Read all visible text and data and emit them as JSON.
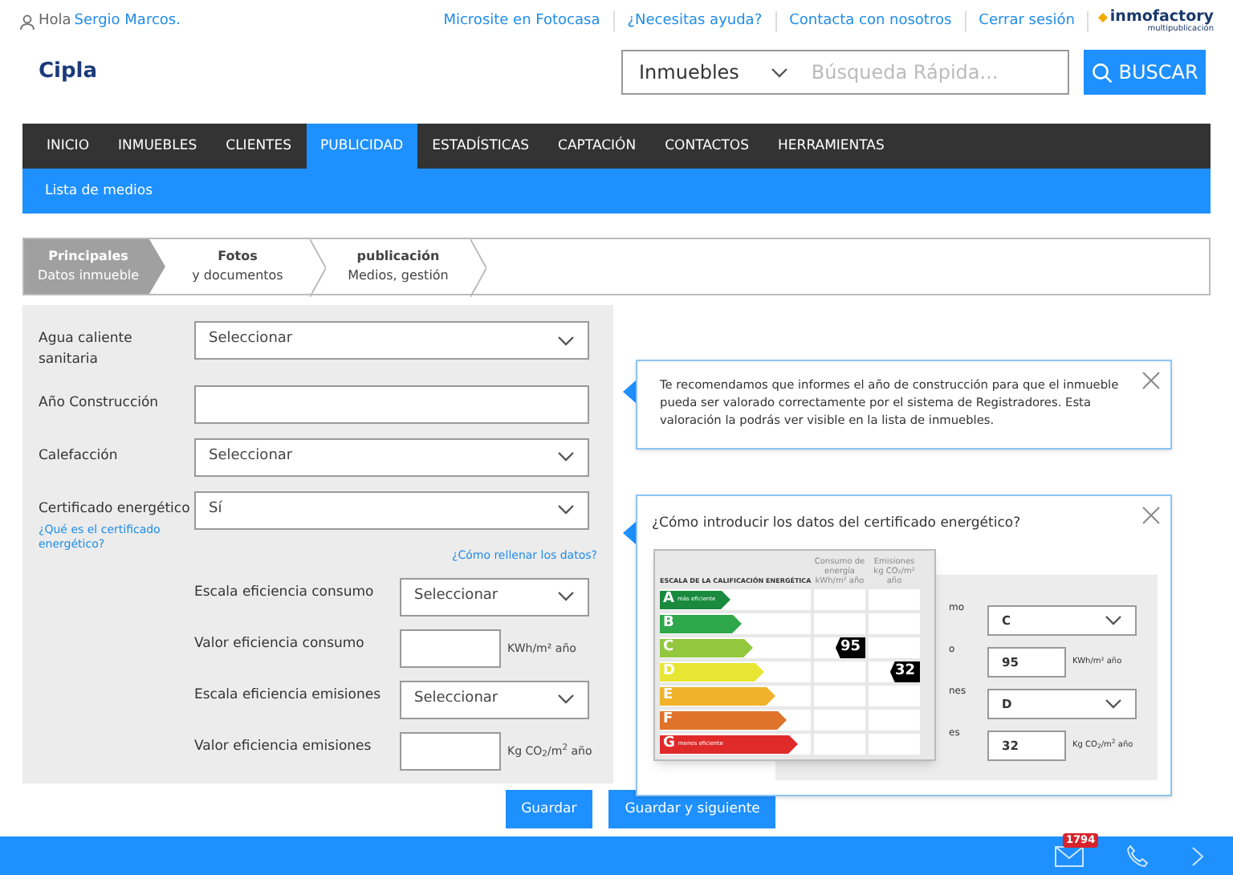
{
  "header": {
    "greeting": "Hola",
    "user": "Sergio Marcos.",
    "links": [
      "Microsite en Fotocasa",
      "¿Necesitas ayuda?",
      "Contacta con nosotros",
      "Cerrar sesión"
    ],
    "brand": "inmofactory",
    "brand_sub": "multipublicación",
    "logo": "Cipla"
  },
  "search": {
    "category": "Inmuebles",
    "placeholder": "Búsqueda Rápida...",
    "button": "BUSCAR"
  },
  "nav": [
    {
      "label": "INICIO",
      "selected": false
    },
    {
      "label": "INMUEBLES",
      "selected": false
    },
    {
      "label": "CLIENTES",
      "selected": false
    },
    {
      "label": "PUBLICIDAD",
      "selected": true
    },
    {
      "label": "ESTADÍSTICAS",
      "selected": false
    },
    {
      "label": "CAPTACIÓN",
      "selected": false
    },
    {
      "label": "CONTACTOS",
      "selected": false
    },
    {
      "label": "HERRAMIENTAS",
      "selected": false
    }
  ],
  "subnav": "Lista de medios",
  "steps": [
    {
      "title": "Principales",
      "subtitle": "Datos inmueble",
      "selected": true
    },
    {
      "title": "Fotos",
      "subtitle": "y documentos",
      "selected": false
    },
    {
      "title": "publicación",
      "subtitle": "Medios, gestión",
      "selected": false
    }
  ],
  "fields": [
    {
      "label": "Agua caliente sanitaria",
      "kind": "select",
      "value": "Seleccionar"
    },
    {
      "label": "Año Construcción",
      "kind": "text"
    },
    {
      "label": "Calefacción",
      "kind": "select",
      "value": "Seleccionar"
    },
    {
      "label": "Certificado energético",
      "kind": "select",
      "value": "Sí",
      "link": "¿Qué es el certificado energético?"
    }
  ],
  "help_link": "¿Cómo rellenar los datos?",
  "subfields": [
    {
      "label": "Escala eficiencia consumo",
      "kind": "select",
      "value": "Seleccionar"
    },
    {
      "label": "Valor eficiencia consumo",
      "kind": "text",
      "unit": "KWh/m² año"
    },
    {
      "label": "Escala eficiencia emisiones",
      "kind": "select",
      "value": "Seleccionar"
    },
    {
      "label": "Valor eficiencia emisiones",
      "kind": "text",
      "unit": "Kg CO$_{2}$/m$^{2}$ año"
    }
  ],
  "tip": "Te recomendamos que informes el año de construcción para que el inmueble pueda ser valorado correctamente por el sistema de Registradores. Esta valoración la podrás ver visible en la lista de inmuebles.",
  "cert_help": {
    "title": "¿Cómo introducir los datos del certificado energético?",
    "scale_title": "ESCALA DE LA CALIFICACIÓN ENERGÉTICA",
    "col_consumption": "Consumo de energía kWh/m² año",
    "col_emissions": "Emisiones kg CO₂/m² año",
    "grades": [
      {
        "letter": "A",
        "color": "#1a8a3e",
        "note": "más eficiente"
      },
      {
        "letter": "B",
        "color": "#2ea84a"
      },
      {
        "letter": "C",
        "color": "#93c83e",
        "consumption": "95"
      },
      {
        "letter": "D",
        "color": "#e8e535",
        "emissions": "32"
      },
      {
        "letter": "E",
        "color": "#efb22a"
      },
      {
        "letter": "F",
        "color": "#e0732a"
      },
      {
        "letter": "G",
        "color": "#e02a2a",
        "note": "menos eficiente"
      }
    ],
    "example": [
      {
        "label_tail": "mo",
        "kind": "select",
        "value": "C"
      },
      {
        "label_tail": "o",
        "kind": "text",
        "value": "95",
        "unit": "KWh/m² año"
      },
      {
        "label_tail": "nes",
        "kind": "select",
        "value": "D"
      },
      {
        "label_tail": "es",
        "kind": "text",
        "value": "32",
        "unit": "Kg CO$_{2}$/m$^{2}$ año"
      }
    ]
  },
  "buttons": [
    "Guardar",
    "Guardar y siguiente"
  ],
  "footer": {
    "mail_count": "1794"
  }
}
